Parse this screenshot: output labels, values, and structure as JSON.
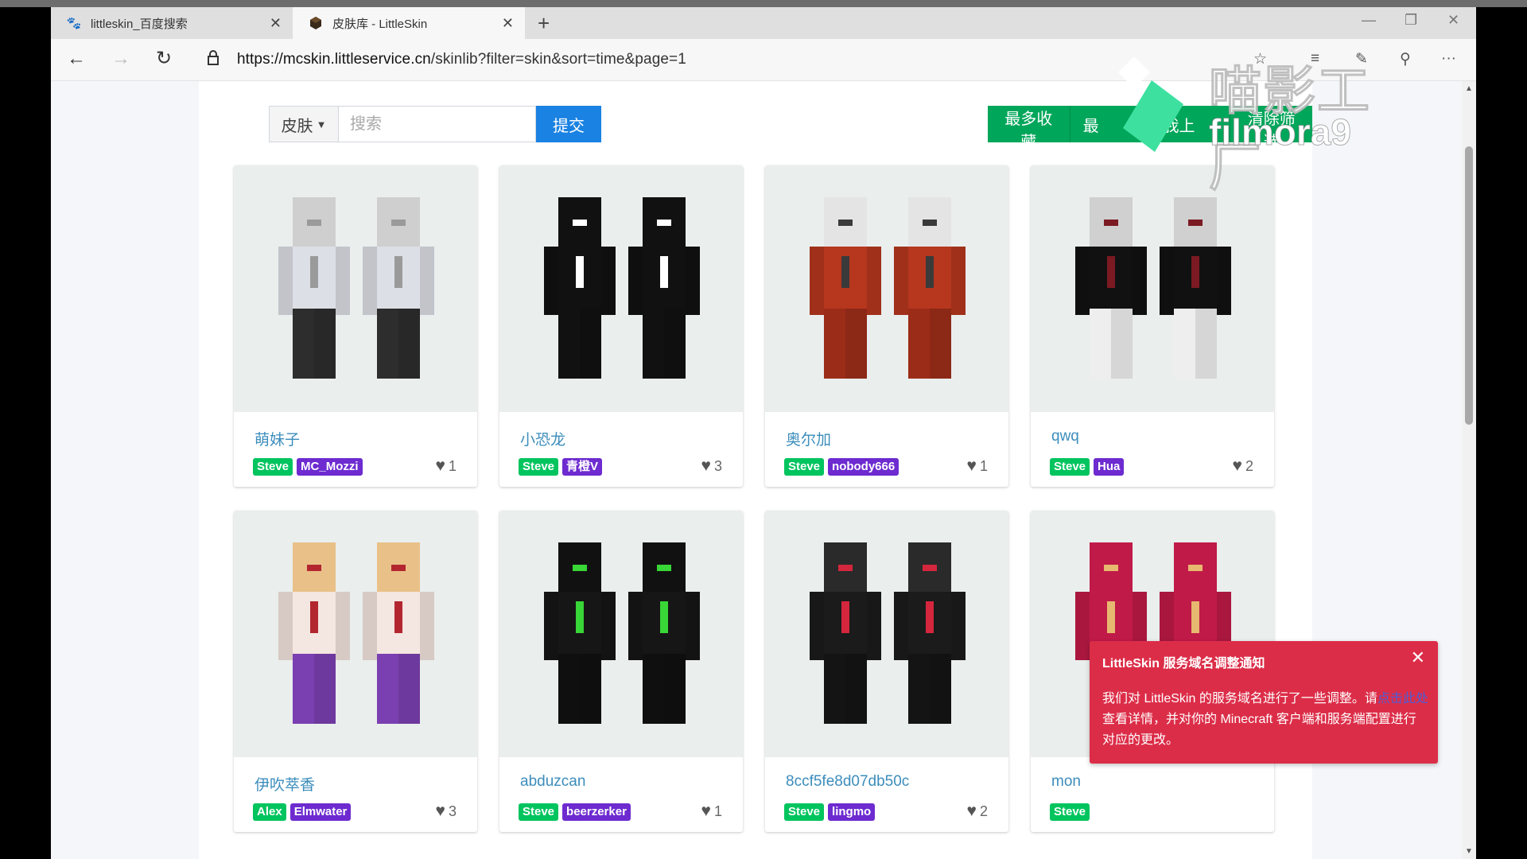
{
  "browser": {
    "tabs": [
      {
        "title": "littleskin_百度搜索",
        "icon": "baidu-paw-icon"
      },
      {
        "title": "皮肤库 - LittleSkin",
        "icon": "littleskin-icon"
      }
    ],
    "url_host": "https://mcskin.littleservice.cn",
    "url_path": "/skinlib?filter=skin&sort=time&page=1"
  },
  "toolbar": {
    "filter_label": "皮肤",
    "search_placeholder": "搜索",
    "submit_label": "提交",
    "sort_buttons": [
      "最多收藏",
      "最",
      "我上",
      "清除筛选"
    ]
  },
  "cards": [
    {
      "name": "萌妹子",
      "model": "Steve",
      "uploader": "MC_Mozzi",
      "likes": "1"
    },
    {
      "name": "小恐龙",
      "model": "Steve",
      "uploader": "青橙V",
      "likes": "3"
    },
    {
      "name": "奥尔加",
      "model": "Steve",
      "uploader": "nobody666",
      "likes": "1"
    },
    {
      "name": "qwq",
      "model": "Steve",
      "uploader": "Hua",
      "likes": "2"
    },
    {
      "name": "伊吹萃香",
      "model": "Alex",
      "uploader": "Elmwater",
      "likes": "3"
    },
    {
      "name": "abduzcan",
      "model": "Steve",
      "uploader": "beerzerker",
      "likes": "1"
    },
    {
      "name": "8ccf5fe8d07db50c",
      "model": "Steve",
      "uploader": "lingmo",
      "likes": "2"
    },
    {
      "name": "mon",
      "model": "Steve",
      "uploader": "",
      "likes": ""
    }
  ],
  "skin_colors": [
    {
      "head": "#cfcfcf",
      "body": "#dcdfe6",
      "legs": "#2d2d2d",
      "accent": "#9a9a9a"
    },
    {
      "head": "#111111",
      "body": "#111111",
      "legs": "#111111",
      "accent": "#ffffff"
    },
    {
      "head": "#e4e4e4",
      "body": "#b6361e",
      "legs": "#9b2c18",
      "accent": "#3a3a3a"
    },
    {
      "head": "#d0d0d0",
      "body": "#111111",
      "legs": "#eeeeee",
      "accent": "#7b1a22"
    },
    {
      "head": "#e9c088",
      "body": "#f4e6e0",
      "legs": "#7a3fb0",
      "accent": "#b32630"
    },
    {
      "head": "#111111",
      "body": "#161616",
      "legs": "#0f0f0f",
      "accent": "#38d636"
    },
    {
      "head": "#2a2a2a",
      "body": "#1b1b1b",
      "legs": "#141414",
      "accent": "#d4263d"
    },
    {
      "head": "#c01a48",
      "body": "#c01a48",
      "legs": "#a8173f",
      "accent": "#e7b86f"
    }
  ],
  "toast": {
    "title": "LittleSkin 服务域名调整通知",
    "body_1": "我们对 LittleSkin 的服务域名进行了一些调整。请",
    "link": "点击此处",
    "body_2": "查看详情，并对你的 Minecraft 客户端和服务端配置进行对应的更改。"
  },
  "watermark": {
    "cn": "喵影工厂",
    "en": "filmora9"
  }
}
